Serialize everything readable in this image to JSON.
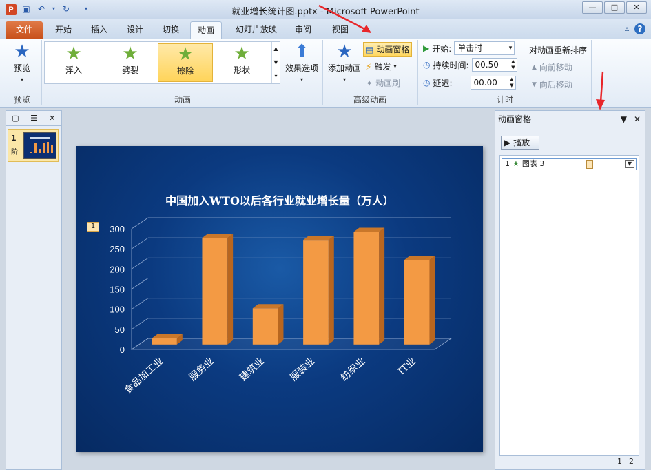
{
  "app": {
    "window_title": "就业增长统计图.pptx - Microsoft PowerPoint",
    "icon_letter": "P"
  },
  "tabs": {
    "file": "文件",
    "items": [
      "开始",
      "插入",
      "设计",
      "切换",
      "动画",
      "幻灯片放映",
      "审阅",
      "视图"
    ],
    "active": "动画"
  },
  "ribbon": {
    "preview": {
      "label": "预览",
      "group": "预览"
    },
    "animation_gallery": {
      "items": [
        "浮入",
        "劈裂",
        "擦除",
        "形状"
      ],
      "selected": "擦除",
      "group": "动画"
    },
    "effect_options": "效果选项",
    "advanced": {
      "add_animation": "添加动画",
      "animation_pane": "动画窗格",
      "trigger": "触发",
      "animation_painter": "动画刷",
      "group": "高级动画"
    },
    "timing": {
      "start_label": "开始:",
      "start_value": "单击时",
      "duration_label": "持续时间:",
      "duration_value": "00.50",
      "delay_label": "延迟:",
      "delay_value": "00.00",
      "reorder_title": "对动画重新排序",
      "move_earlier": "向前移动",
      "move_later": "向后移动",
      "group": "计时"
    }
  },
  "slides_panel": {
    "slide_number": "1",
    "slide_sub": "阶"
  },
  "slide": {
    "animation_tag": "1"
  },
  "chart_data": {
    "type": "bar",
    "title": "中国加入WTO以后各行业就业增长量（万人）",
    "categories": [
      "食品加工业",
      "服务业",
      "建筑业",
      "服装业",
      "纺织业",
      "IT业"
    ],
    "values": [
      15,
      265,
      90,
      260,
      280,
      210
    ],
    "ylim": [
      0,
      300
    ],
    "yticks": [
      0,
      50,
      100,
      150,
      200,
      250,
      300
    ],
    "grid": true,
    "bar_color": "#f39a44",
    "legend": "none"
  },
  "animation_pane": {
    "title": "动画窗格",
    "play_label": "播放",
    "item": {
      "number": "1",
      "name": "图表 3"
    },
    "footer_pages": [
      "1",
      "2"
    ]
  },
  "colors": {
    "file_tab": "#c8511b",
    "slide_bg": "#0b3a80",
    "highlight": "#ffd75f",
    "red_arrow": "#e8262a"
  }
}
